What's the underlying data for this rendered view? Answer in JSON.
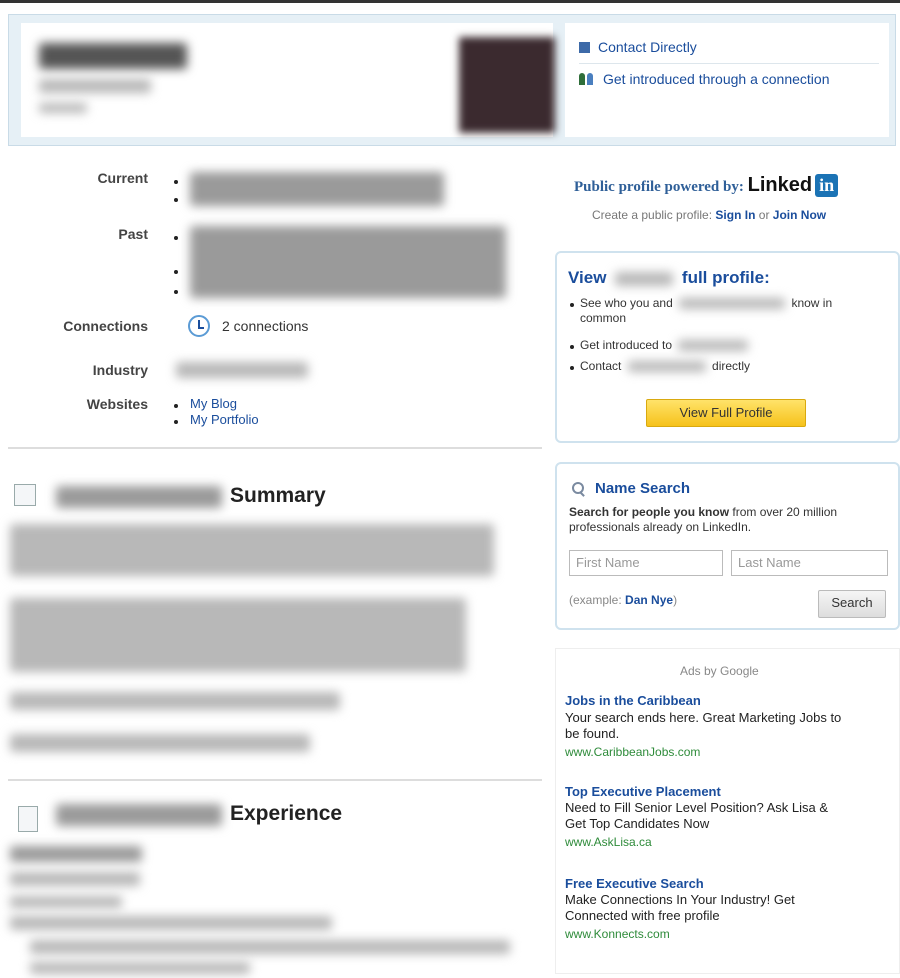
{
  "contact": {
    "direct_label": "Contact Directly",
    "introduced_label": "Get introduced through a connection"
  },
  "profile": {
    "current_label": "Current",
    "past_label": "Past",
    "connections_label": "Connections",
    "connections_value": "2 connections",
    "industry_label": "Industry",
    "websites_label": "Websites",
    "websites": [
      "My Blog",
      "My Portfolio"
    ]
  },
  "sections": {
    "summary_title": "Summary",
    "experience_title": "Experience"
  },
  "powered": {
    "text": "Public profile powered by:",
    "brand": "Linked",
    "brand_box": "in",
    "create_prefix": "Create a public profile:",
    "sign_in": "Sign In",
    "or": "or",
    "join_now": "Join Now"
  },
  "full_profile": {
    "view_word": "View",
    "title_suffix": "full profile:",
    "bullet1_prefix": "See who you and",
    "bullet1_suffix": "know in",
    "bullet1_cont": "common",
    "bullet2_prefix": "Get introduced to",
    "bullet3_prefix": "Contact",
    "bullet3_suffix": "directly",
    "button": "View Full Profile"
  },
  "name_search": {
    "title": "Name Search",
    "desc_bold": "Search for people you know",
    "desc_rest": "from over 20 million",
    "desc_line2": "professionals already on LinkedIn.",
    "first_placeholder": "First Name",
    "last_placeholder": "Last Name",
    "example_prefix": "(example:",
    "example_name": "Dan Nye",
    "example_suffix": ")",
    "button": "Search"
  },
  "ads": {
    "heading": "Ads by Google",
    "items": [
      {
        "title": "Jobs in the Caribbean",
        "line1": "Your search ends here. Great Marketing Jobs to",
        "line2": "be found.",
        "url": "www.CaribbeanJobs.com"
      },
      {
        "title": "Top Executive Placement",
        "line1": "Need to Fill Senior Level Position? Ask Lisa &",
        "line2": "Get Top Candidates Now",
        "url": "www.AskLisa.ca"
      },
      {
        "title": "Free Executive Search",
        "line1": "Make Connections In Your Industry! Get",
        "line2": "Connected with free profile",
        "url": "www.Konnects.com"
      }
    ]
  },
  "colors": {
    "link": "#1a4d9c",
    "accent_bg": "#e6f0f6",
    "button_yellow": "#f6c21b",
    "ad_url_green": "#2e8b3a"
  }
}
